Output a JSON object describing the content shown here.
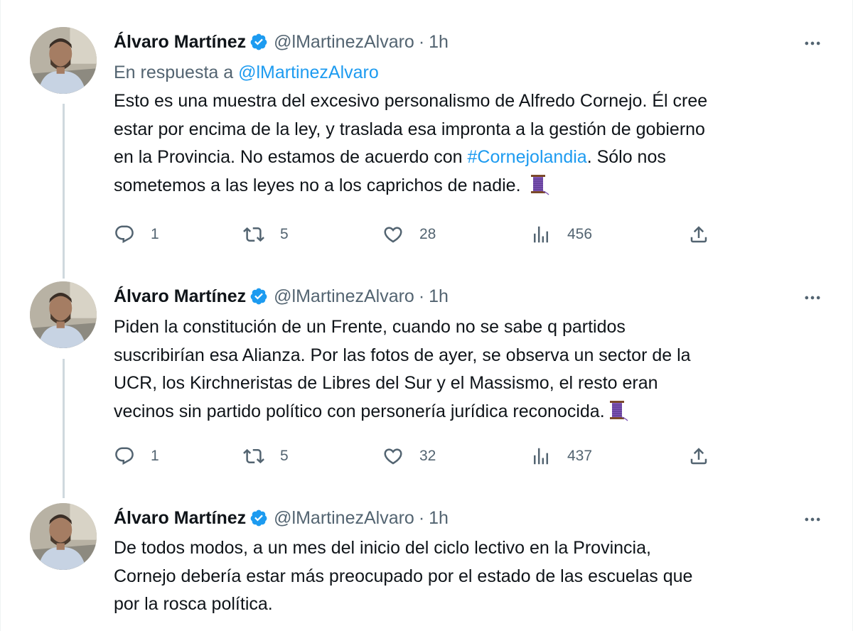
{
  "tweets": [
    {
      "author": {
        "name": "Álvaro Martínez",
        "handle": "@lMartinezAlvaro",
        "time": "1h"
      },
      "reply_prefix": "En respuesta a",
      "reply_handle": "@lMartinezAlvaro",
      "lines": [
        "Esto es una muestra del excesivo personalismo de Alfredo Cornejo. Él cree",
        "estar por encima de la ley, y traslada esa impronta a la gestión de gobierno",
        "en la Provincia. No estamos de acuerdo con ",
        "sometemos a las leyes no a los caprichos de nadie."
      ],
      "hashtag": "#Cornejolandia",
      "line3_after": ". Sólo nos",
      "stats": {
        "replies": "1",
        "retweets": "5",
        "likes": "28",
        "views": "456"
      }
    },
    {
      "author": {
        "name": "Álvaro Martínez",
        "handle": "@lMartinezAlvaro",
        "time": "1h"
      },
      "lines": [
        "Piden la constitución de un Frente, cuando no se sabe q partidos",
        "suscribirían esa Alianza. Por las fotos de ayer, se observa un sector de la",
        "UCR, los Kirchneristas de Libres del Sur y el Massismo, el resto eran",
        "vecinos sin partido político con personería jurídica reconocida."
      ],
      "stats": {
        "replies": "1",
        "retweets": "5",
        "likes": "32",
        "views": "437"
      }
    },
    {
      "author": {
        "name": "Álvaro Martínez",
        "handle": "@lMartinezAlvaro",
        "time": "1h"
      },
      "lines": [
        "De todos modos, a un mes del inicio del ciclo lectivo en la Provincia,",
        "Cornejo debería estar más preocupado por el estado de las escuelas que",
        "por la rosca política."
      ]
    }
  ],
  "separator": "·",
  "icons": [
    "verified-badge-icon",
    "more-icon",
    "reply-icon",
    "retweet-icon",
    "like-icon",
    "views-icon",
    "share-icon",
    "thread-emoji-icon"
  ],
  "colors": {
    "accent": "#1d9bf0",
    "muted": "#536471",
    "text": "#0f1419",
    "thread_line": "#cfd9de"
  }
}
